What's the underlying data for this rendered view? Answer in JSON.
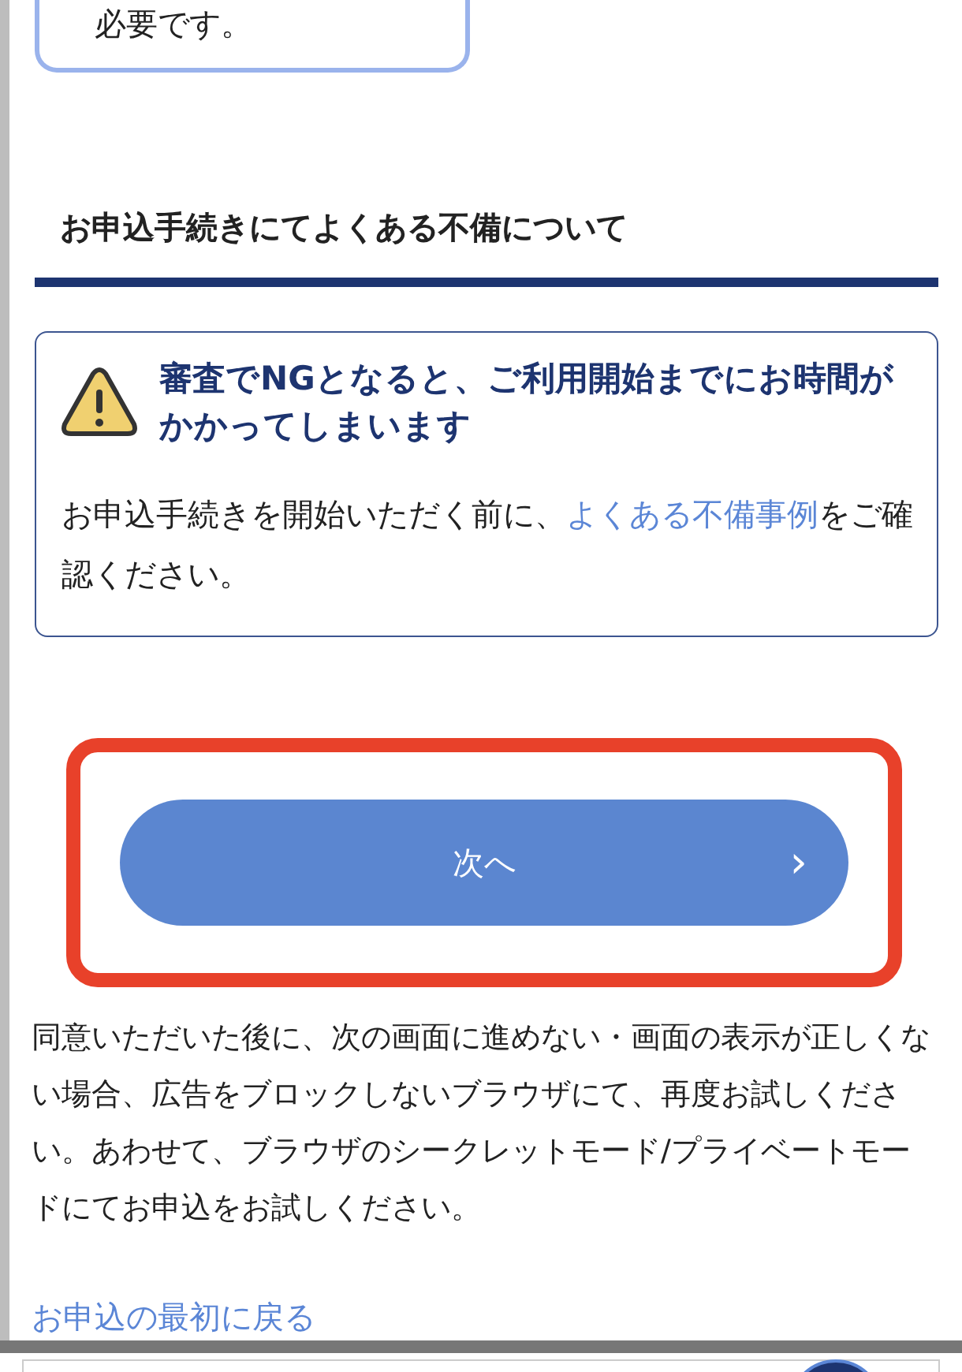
{
  "previous_card": {
    "text": "必要です。"
  },
  "section": {
    "heading": "お申込手続きにてよくある不備について"
  },
  "warning": {
    "title": "審査でNGとなると、ご利用開始までにお時間がかかってしまいます",
    "body_before": "お申込手続きを開始いただく前に、",
    "body_link": "よくある不備事例",
    "body_after": "をご確認ください。"
  },
  "next_button": {
    "label": "次へ",
    "arrow": "›",
    "highlighted": true
  },
  "notice": "同意いただいた後に、次の画面に進めない・画面の表示が正しくない場合、広告をブロックしないブラウザにて、再度お試しください。あわせて、ブラウザのシークレットモード/プライベートモードにてお申込をお試しください。",
  "back_link": "お申込の最初に戻る"
}
